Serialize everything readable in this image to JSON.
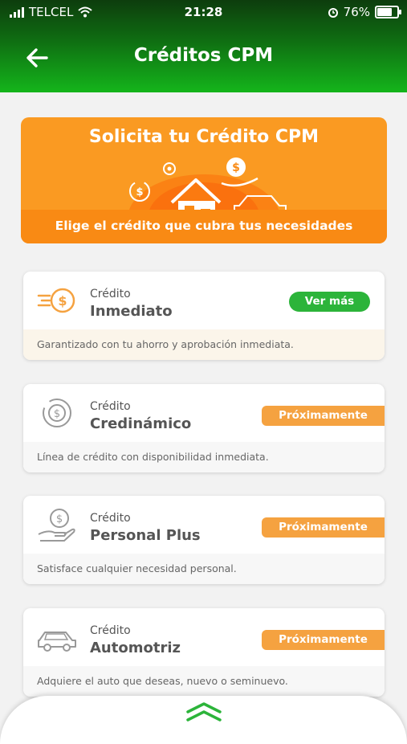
{
  "status_bar": {
    "carrier": "TELCEL",
    "time": "21:28",
    "battery": "76%",
    "battery_level": 0.76
  },
  "header": {
    "title": "Créditos CPM"
  },
  "banner": {
    "headline": "Solicita tu Crédito CPM",
    "subtitle": "Elige el crédito que cubra tus necesidades",
    "bg_color": "#fa9a22"
  },
  "cards": [
    {
      "kicker": "Crédito",
      "name": "Inmediato",
      "action": "Ver más",
      "description": "Garantizado con tu ahorro y aprobación inmediata.",
      "icon": "money-speed-icon"
    },
    {
      "kicker": "Crédito",
      "name": "Credinámico",
      "action": "Próximamente",
      "description": "Línea de crédito con disponibilidad inmediata.",
      "icon": "money-cycle-icon"
    },
    {
      "kicker": "Crédito",
      "name": "Personal Plus",
      "action": "Próximamente",
      "description": "Satisface cualquier necesidad personal.",
      "icon": "hand-money-icon"
    },
    {
      "kicker": "Crédito",
      "name": "Automotriz",
      "action": "Próximamente",
      "description": "Adquiere el auto que deseas, nuevo o seminuevo.",
      "icon": "car-icon"
    }
  ],
  "colors": {
    "green": "#2cb43a",
    "orange": "#f5a240",
    "header_green": "#14b51b"
  }
}
